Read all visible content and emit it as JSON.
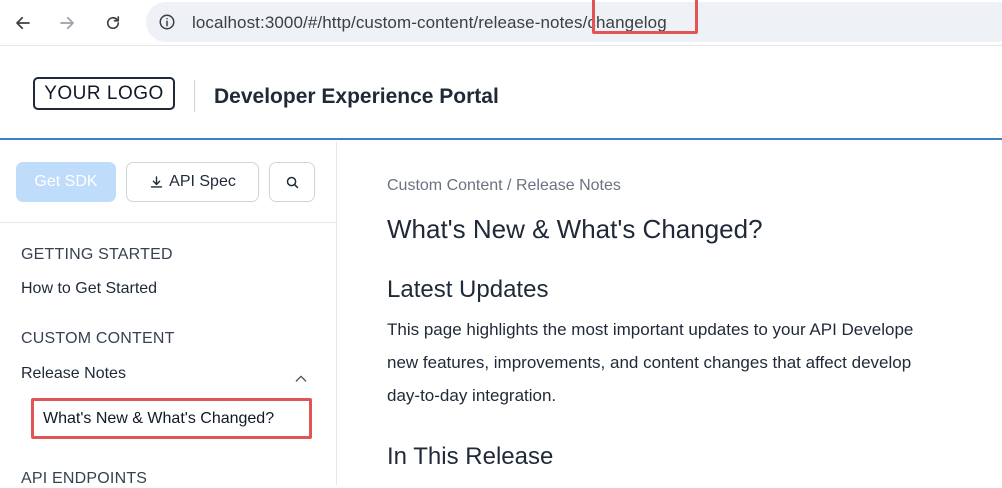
{
  "browser": {
    "url": "localhost:3000/#/http/custom-content/release-notes/changelog"
  },
  "header": {
    "logo": "YOUR LOGO",
    "title": "Developer Experience Portal"
  },
  "sidebar": {
    "get_sdk_label": "Get SDK",
    "api_spec_label": "API Spec",
    "sections": [
      {
        "heading": "GETTING STARTED",
        "items": [
          "How to Get Started"
        ]
      },
      {
        "heading": "CUSTOM CONTENT",
        "items": [
          "Release Notes"
        ]
      },
      {
        "heading": "API ENDPOINTS"
      }
    ],
    "active_item": "What's New & What's Changed?"
  },
  "main": {
    "breadcrumb": "Custom Content / Release Notes",
    "title": "What's New & What's Changed?",
    "section1_heading": "Latest Updates",
    "paragraph_lines": [
      "This page highlights the most important updates to your API Develope",
      "new features, improvements, and content changes that affect develop",
      "day-to-day integration."
    ],
    "section2_heading": "In This Release"
  },
  "colors": {
    "accent": "#3b82c4",
    "highlight": "#e05555",
    "sdk_button": "#bfdcfb"
  }
}
